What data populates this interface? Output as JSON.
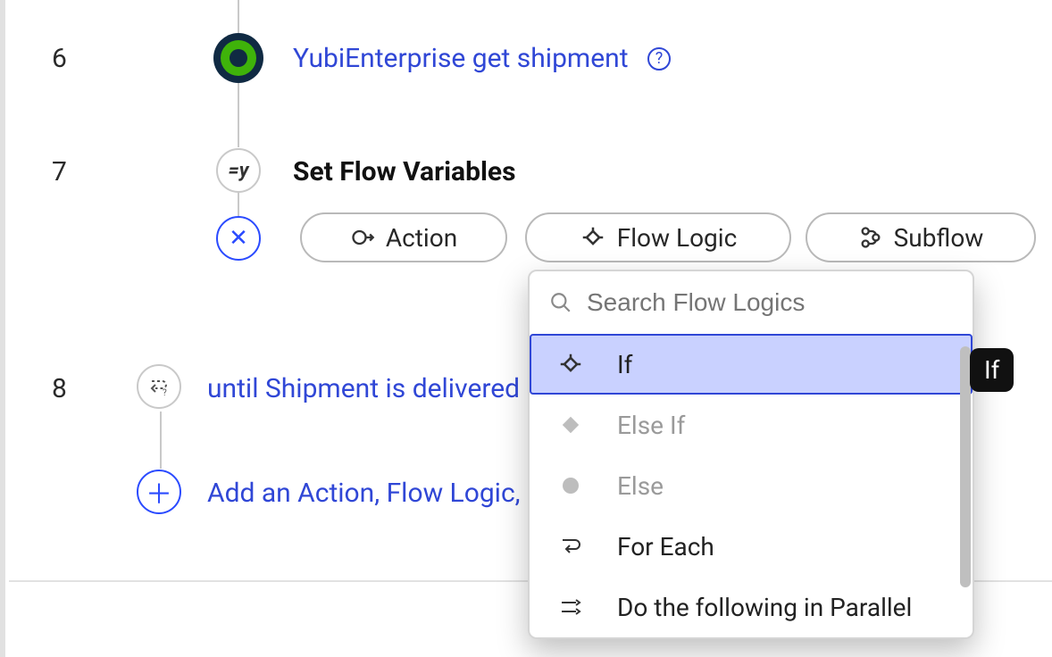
{
  "steps": {
    "s6": {
      "num": "6",
      "label": "YubiEnterprise get shipment"
    },
    "s7": {
      "num": "7",
      "label": "Set Flow Variables"
    },
    "s8": {
      "num": "8",
      "label": "until Shipment is delivered"
    }
  },
  "buttons": {
    "action": "Action",
    "flow_logic": "Flow Logic",
    "subflow": "Subflow"
  },
  "add_row": {
    "label": "Add an Action, Flow Logic, or Subflow"
  },
  "dropdown": {
    "search_placeholder": "Search Flow Logics",
    "items": {
      "if": "If",
      "elseif": "Else If",
      "else": "Else",
      "foreach": "For Each",
      "parallel": "Do the following in Parallel"
    }
  },
  "tooltip": {
    "text": "If"
  },
  "icons": {
    "equals_y": "=y",
    "close": "✕",
    "plus": "＋"
  }
}
